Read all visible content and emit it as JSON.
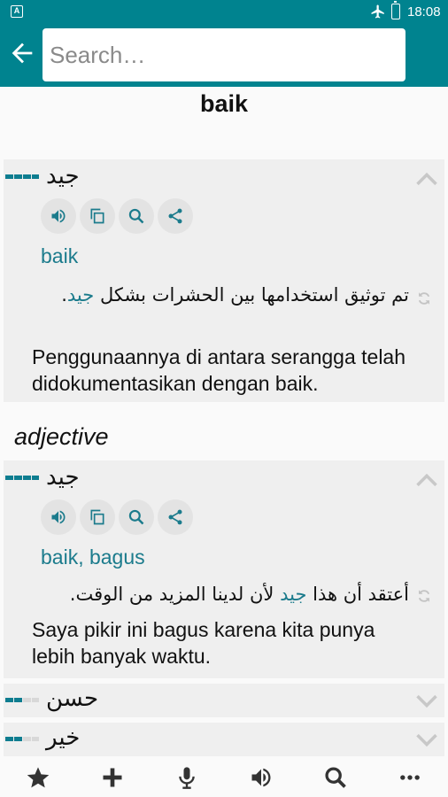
{
  "status_bar": {
    "time": "18:08",
    "app_badge": "A"
  },
  "search": {
    "placeholder": "Search…"
  },
  "headword": "baik",
  "entries": [
    {
      "arabic": "جيد",
      "translation": "baik",
      "example_ar_before": "تم توثيق استخدامها بين الحشرات بشكل",
      "example_ar_highlight": "جيد",
      "example_ar_after": ".",
      "example_id": "Penggunaannya di antara serangga telah didokumentasikan dengan baik."
    },
    {
      "arabic": "جيد",
      "translation": "baik, bagus",
      "example_ar_before": "أعتقد أن هذا",
      "example_ar_highlight": "جيد",
      "example_ar_after": "لأن لدينا المزيد من الوقت.",
      "example_id": "Saya pikir ini bagus karena kita punya lebih banyak waktu."
    }
  ],
  "part_of_speech": "adjective",
  "collapsed_entries": [
    {
      "arabic": "حسن"
    },
    {
      "arabic": "خير"
    }
  ],
  "icons": {
    "back": "arrow-left-icon",
    "speaker": "speaker-icon",
    "copy": "copy-icon",
    "search": "search-icon",
    "share": "share-icon",
    "refresh": "refresh-icon",
    "nav": [
      "star-icon",
      "plus-icon",
      "microphone-icon",
      "speaker-icon",
      "search-icon",
      "more-icon"
    ]
  },
  "colors": {
    "accent": "#00838f",
    "link": "#1b7b8c",
    "frequency_bar": "#0e7d90"
  }
}
